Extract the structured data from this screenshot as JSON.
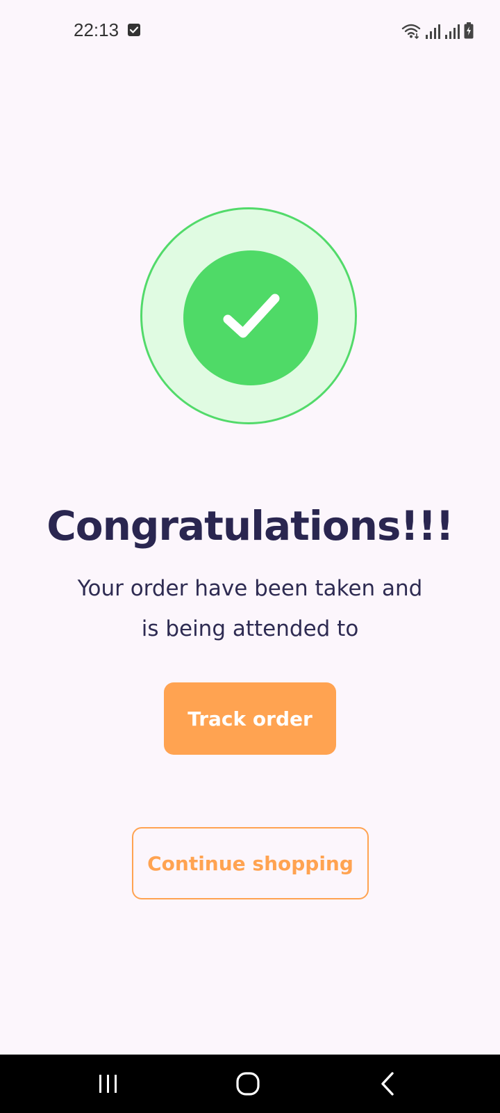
{
  "status_bar": {
    "time": "22:13",
    "icons": [
      "checkbox-notification-icon",
      "wifi-icon",
      "signal-icon",
      "signal-icon",
      "battery-charging-icon"
    ]
  },
  "success_badge": {
    "icon": "checkmark-icon",
    "colors": {
      "outer_fill": "#e0fbe2",
      "outer_ring": "#52da6a",
      "inner_fill": "#4fda67"
    }
  },
  "content": {
    "title": "Congratulations!!!",
    "message_line1": "Your order have been taken and",
    "message_line2": "is being attended to"
  },
  "actions": {
    "track_order_label": "Track order",
    "continue_shopping_label": "Continue shopping",
    "accent_color": "#ffa351"
  },
  "nav_bar": {
    "buttons": [
      "recent-apps-icon",
      "home-icon",
      "back-icon"
    ]
  }
}
